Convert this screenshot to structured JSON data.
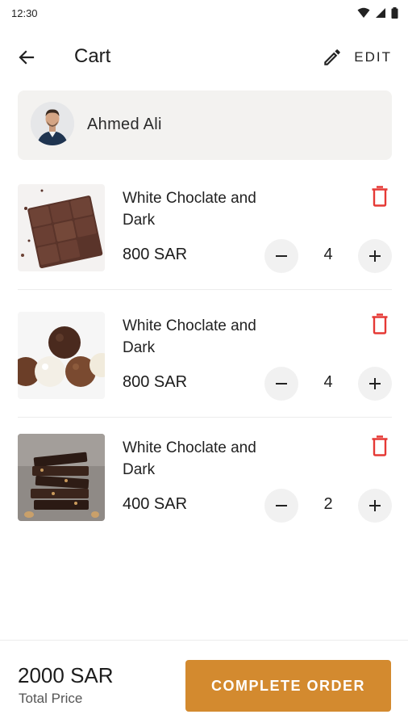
{
  "status_bar": {
    "time": "12:30",
    "icons": [
      "wifi-icon",
      "signal-icon",
      "battery-icon"
    ]
  },
  "header": {
    "back_icon": "arrow-left-icon",
    "title": "Cart",
    "edit_icon": "pencil-icon",
    "edit_label": "EDIT"
  },
  "user": {
    "name": "Ahmed Ali",
    "avatar": "user-avatar"
  },
  "cart_items": [
    {
      "name": "White Choclate and Dark",
      "price": "800 SAR",
      "quantity": "4",
      "thumb": "chocolate-bar-image"
    },
    {
      "name": "White Choclate and Dark",
      "price": "800 SAR",
      "quantity": "4",
      "thumb": "truffles-image"
    },
    {
      "name": "White Choclate and Dark",
      "price": "400 SAR",
      "quantity": "2",
      "thumb": "chocolate-stack-image"
    }
  ],
  "footer": {
    "total_price": "2000 SAR",
    "total_label": "Total Price",
    "complete_label": "COMPLETE ORDER"
  },
  "colors": {
    "accent": "#d38a2f",
    "delete": "#e53935",
    "card_bg": "#f3f2f0"
  }
}
